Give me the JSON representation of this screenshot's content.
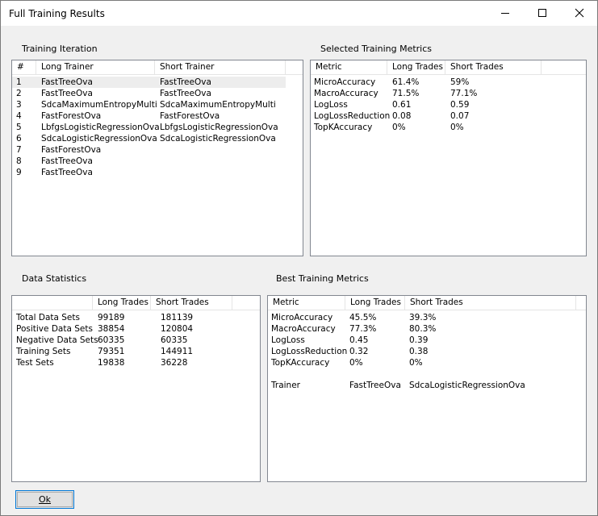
{
  "window": {
    "title": "Full Training Results"
  },
  "training_iteration": {
    "label": "Training Iteration",
    "columns": [
      "#",
      "Long Trainer",
      "Short Trainer"
    ],
    "rows": [
      [
        "1",
        "FastTreeOva",
        "FastTreeOva"
      ],
      [
        "2",
        "FastTreeOva",
        "FastTreeOva"
      ],
      [
        "3",
        "SdcaMaximumEntropyMulti",
        "SdcaMaximumEntropyMulti"
      ],
      [
        "4",
        "FastForestOva",
        "FastForestOva"
      ],
      [
        "5",
        "LbfgsLogisticRegressionOva",
        "LbfgsLogisticRegressionOva"
      ],
      [
        "6",
        "SdcaLogisticRegressionOva",
        "SdcaLogisticRegressionOva"
      ],
      [
        "7",
        "FastForestOva",
        ""
      ],
      [
        "8",
        "FastTreeOva",
        ""
      ],
      [
        "9",
        "FastTreeOva",
        ""
      ]
    ]
  },
  "selected_metrics": {
    "label": "Selected Training Metrics",
    "columns": [
      "Metric",
      "Long Trades",
      "Short Trades"
    ],
    "rows": [
      [
        "MicroAccuracy",
        "61.4%",
        "59%"
      ],
      [
        "MacroAccuracy",
        "71.5%",
        "77.1%"
      ],
      [
        "LogLoss",
        "0.61",
        "0.59"
      ],
      [
        "LogLossReduction",
        "0.08",
        "0.07"
      ],
      [
        "TopKAccuracy",
        "0%",
        "0%"
      ]
    ]
  },
  "data_statistics": {
    "label": "Data Statistics",
    "columns": [
      "",
      "Long Trades",
      "Short Trades"
    ],
    "rows": [
      [
        "Total Data Sets",
        "99189",
        "181139"
      ],
      [
        "Positive Data Sets",
        "38854",
        "120804"
      ],
      [
        "Negative Data Sets",
        "60335",
        "60335"
      ],
      [
        "Training Sets",
        "79351",
        "144911"
      ],
      [
        "Test Sets",
        "19838",
        "36228"
      ]
    ]
  },
  "best_metrics": {
    "label": "Best Training Metrics",
    "columns": [
      "Metric",
      "Long Trades",
      "Short Trades"
    ],
    "rows": [
      [
        "MicroAccuracy",
        "45.5%",
        "39.3%"
      ],
      [
        "MacroAccuracy",
        "77.3%",
        "80.3%"
      ],
      [
        "LogLoss",
        "0.45",
        "0.39"
      ],
      [
        "LogLossReduction",
        "0.32",
        "0.38"
      ],
      [
        "TopKAccuracy",
        "0%",
        "0%"
      ],
      [
        "",
        "",
        ""
      ],
      [
        "Trainer",
        "FastTreeOva",
        "SdcaLogisticRegressionOva"
      ]
    ]
  },
  "ok_button": {
    "label": "Ok"
  }
}
